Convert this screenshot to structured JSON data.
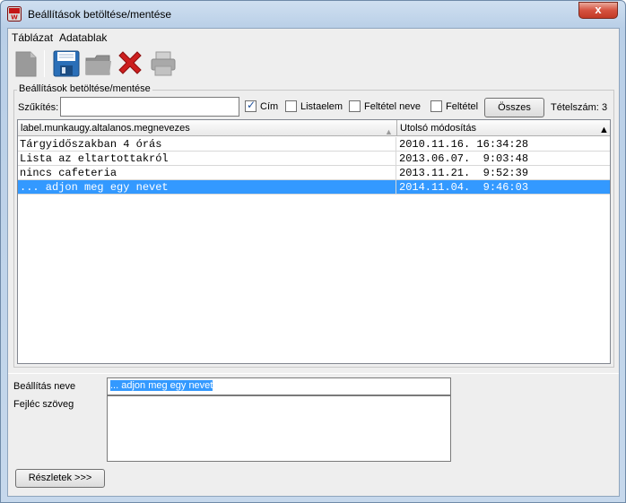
{
  "window": {
    "title": "Beállítások betöltése/mentése",
    "close_label": "x"
  },
  "menu": [
    "Táblázat",
    "Adatablak"
  ],
  "toolbar": {
    "icons": [
      "new-document-icon",
      "save-disk-icon",
      "open-folder-icon",
      "delete-x-icon",
      "print-icon"
    ]
  },
  "group": {
    "label": "Beállítások betöltése/mentése"
  },
  "filter": {
    "label": "Szűkítés:",
    "value": "",
    "options": [
      {
        "label": "Cím",
        "checked": true
      },
      {
        "label": "Listaelem",
        "checked": false
      },
      {
        "label": "Feltétel neve",
        "checked": false
      },
      {
        "label": "Feltétel",
        "checked": false
      }
    ],
    "all_button": "Összes",
    "count_label": "Tételszám:",
    "count_value": "3"
  },
  "table": {
    "columns": [
      "label.munkaugy.altalanos.megnevezes",
      "Utolsó módosítás"
    ],
    "rows": [
      {
        "name": "Tárgyidőszakban 4 órás",
        "modified": "2010.11.16. 16:34:28",
        "selected": false
      },
      {
        "name": "Lista az eltartottakról",
        "modified": "2013.06.07.  9:03:48",
        "selected": false
      },
      {
        "name": "nincs cafeteria",
        "modified": "2013.11.21.  9:52:39",
        "selected": false
      },
      {
        "name": "... adjon meg egy nevet",
        "modified": "2014.11.04.  9:46:03",
        "selected": true
      }
    ]
  },
  "form": {
    "name_label": "Beállítás neve",
    "name_value": "... adjon meg egy nevet",
    "header_label": "Fejléc szöveg",
    "header_value": ""
  },
  "details_button": "Részletek >>>",
  "colors": {
    "selection": "#3399ff",
    "delete": "#cc1f1f",
    "save": "#2a6fb8"
  }
}
